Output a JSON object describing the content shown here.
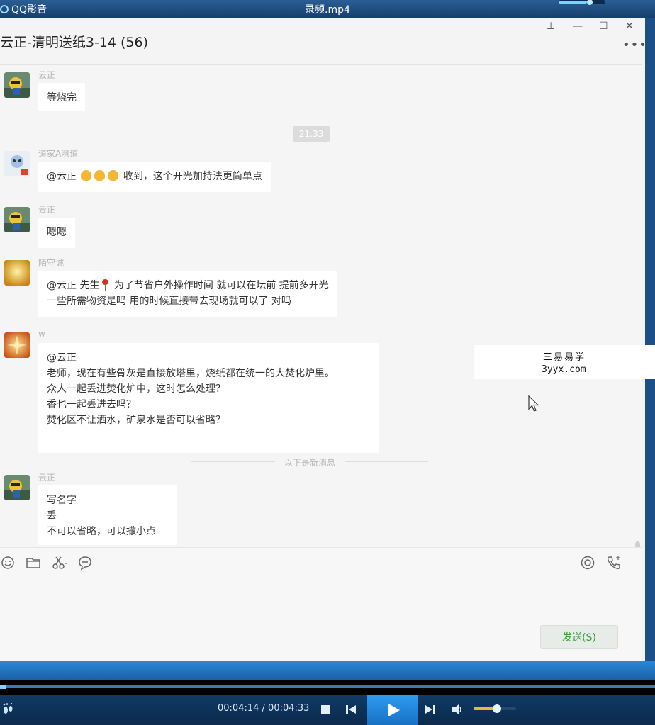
{
  "player": {
    "app_name": "QQ影音",
    "file_name": "录频.mp4",
    "current_time": "00:04:14",
    "separator": " / ",
    "total_time": "00:04:33",
    "progress_fraction": 0.01,
    "volume_fraction": 0.55,
    "top_volume_fraction": 0.6
  },
  "chat": {
    "title": "云正-清明送纸3-14 (56)",
    "window_controls": {
      "pin": "⊥",
      "minimize": "—",
      "maximize": "☐",
      "close": "✕"
    },
    "more_label": "•••",
    "time_divider": "21:33",
    "new_messages_divider": "以下是新消息",
    "messages": [
      {
        "sender": "云正",
        "lines": [
          "等烧完"
        ]
      },
      {
        "sender": "道家A濒道",
        "prefix": "@云正",
        "emoji_count": 3,
        "text": "收到，这个开光加持法更简单点"
      },
      {
        "sender": "云正",
        "lines": [
          "嗯嗯"
        ]
      },
      {
        "sender": "陌守诚",
        "line1_prefix": "@云正 先生",
        "line1_text": " 为了节省户外操作时间 就可以在坛前 提前多开光",
        "line2": "一些所需物资是吗 用的时候直接带去现场就可以了 对吗"
      },
      {
        "sender": "w",
        "lines": [
          "@云正",
          "老师，现在有些骨灰是直接放塔里，烧纸都在统一的大焚化炉里。",
          "众人一起丢进焚化炉中，这时怎么处理？",
          "香也一起丢进去吗？",
          "焚化区不让洒水，矿泉水是否可以省略？"
        ]
      },
      {
        "sender": "云正",
        "lines": [
          "写名字",
          "丢",
          "不可以省略，可以撒小点"
        ]
      }
    ],
    "toolbar_icons": [
      "emoji-icon",
      "folder-icon",
      "scissors-icon",
      "chat-bubble-icon",
      "voice-icon",
      "phone-icon"
    ],
    "send_label": "发送(S)"
  },
  "watermark": {
    "line1": "三易易学",
    "line2": "3yyx.com"
  },
  "colors": {
    "accent_blue": "#1870c4",
    "send_green": "#3d9a3d",
    "bubble": "#ffffff"
  }
}
